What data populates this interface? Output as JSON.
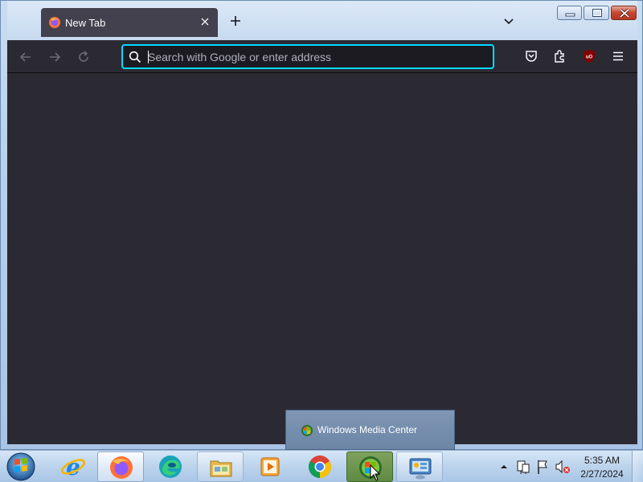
{
  "browser": {
    "tab": {
      "title": "New Tab",
      "icon": "firefox-icon"
    },
    "urlbar": {
      "placeholder": "Search with Google or enter address",
      "value": ""
    },
    "colors": {
      "toolbar": "#2b2a33",
      "content": "#2b2a33",
      "urlbar_focus": "#00ddff",
      "tab_active": "#42414d"
    }
  },
  "toolbar": {
    "back_icon": "arrow-left-icon",
    "forward_icon": "arrow-right-icon",
    "reload_icon": "reload-icon",
    "pocket_icon": "pocket-icon",
    "extensions_icon": "puzzle-icon",
    "ublock_label": "uO",
    "menu_icon": "hamburger-icon"
  },
  "taskbar": {
    "items": [
      {
        "name": "Internet Explorer"
      },
      {
        "name": "Firefox"
      },
      {
        "name": "Edge"
      },
      {
        "name": "File Explorer"
      },
      {
        "name": "Media Player"
      },
      {
        "name": "Chrome"
      },
      {
        "name": "Windows Media Center"
      },
      {
        "name": "Control Panel"
      }
    ],
    "jump_popup": {
      "label": "Windows Media Center"
    },
    "clock": {
      "time": "5:35 AM",
      "date": "2/27/2024"
    }
  }
}
